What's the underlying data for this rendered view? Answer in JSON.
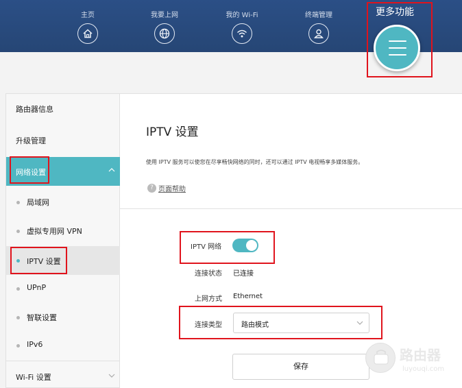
{
  "nav": {
    "items": [
      {
        "label": "主页",
        "icon": "home-icon"
      },
      {
        "label": "我要上网",
        "icon": "globe-icon"
      },
      {
        "label": "我的 Wi-Fi",
        "icon": "wifi-icon"
      },
      {
        "label": "终端管理",
        "icon": "user-icon"
      }
    ],
    "more_label": "更多功能",
    "more_icon": "menu-icon"
  },
  "sidebar": {
    "items": [
      {
        "label": "路由器信息"
      },
      {
        "label": "升级管理"
      },
      {
        "label": "网络设置",
        "state": "expanded"
      },
      {
        "label": "局域网"
      },
      {
        "label": "虚拟专用网 VPN"
      },
      {
        "label": "IPTV 设置",
        "state": "selected"
      },
      {
        "label": "UPnP"
      },
      {
        "label": "智联设置"
      },
      {
        "label": "IPv6"
      },
      {
        "label": "Wi-Fi 设置",
        "state": "collapsed"
      }
    ]
  },
  "main": {
    "title": "IPTV 设置",
    "description": "使用 IPTV 服务可以使您在尽享畅快网络的同时，还可以通过 IPTV 电视畅享多媒体服务。",
    "help_link": "页面帮助",
    "help_icon": "?",
    "form": {
      "iptv_label": "IPTV 网络",
      "iptv_enabled": true,
      "status_label": "连接状态",
      "status_value": "已连接",
      "method_label": "上网方式",
      "method_value": "Ethernet",
      "type_label": "连接类型",
      "type_value": "路由模式"
    },
    "save_label": "保存"
  },
  "watermark": {
    "title": "路由器",
    "url": "luyouqi.com"
  },
  "colors": {
    "accent": "#4fb7c2",
    "topbar": "#2b4f86",
    "highlight": "#e0131c"
  }
}
